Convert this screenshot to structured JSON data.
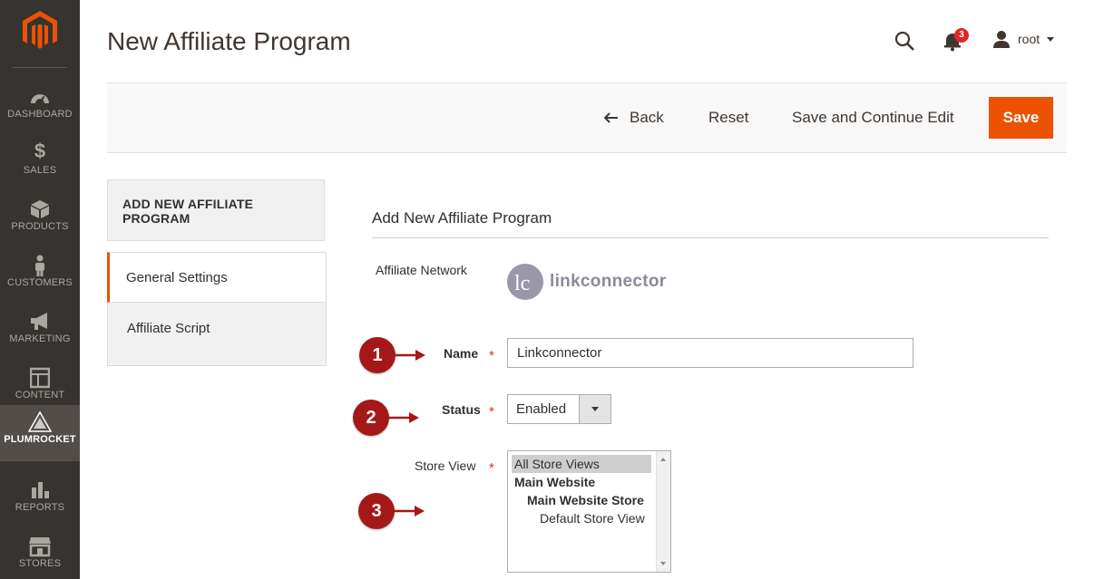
{
  "sidebar": {
    "logo_icon": "magento-logo-icon",
    "items": [
      {
        "label": "DASHBOARD",
        "icon": "dashboard-icon"
      },
      {
        "label": "SALES",
        "icon": "dollar-icon"
      },
      {
        "label": "PRODUCTS",
        "icon": "box-icon"
      },
      {
        "label": "CUSTOMERS",
        "icon": "person-icon"
      },
      {
        "label": "MARKETING",
        "icon": "megaphone-icon"
      },
      {
        "label": "CONTENT",
        "icon": "layout-icon"
      },
      {
        "label": "PLUMROCKET",
        "icon": "plumrocket-icon"
      },
      {
        "label": "REPORTS",
        "icon": "bar-chart-icon"
      },
      {
        "label": "STORES",
        "icon": "store-icon"
      }
    ]
  },
  "header": {
    "title": "New Affiliate Program",
    "notifications_count": "3",
    "user_name": "root"
  },
  "actions": {
    "back_label": "Back",
    "reset_label": "Reset",
    "save_continue_label": "Save and Continue Edit",
    "save_label": "Save"
  },
  "tabs": {
    "heading": "ADD NEW AFFILIATE PROGRAM",
    "items": [
      {
        "label": "General Settings",
        "active": true
      },
      {
        "label": "Affiliate Script",
        "active": false
      }
    ]
  },
  "form": {
    "section_title": "Add New Affiliate Program",
    "network_label": "Affiliate Network",
    "network_logo_text": "linkconnector",
    "name_label": "Name",
    "name_value": "Linkconnector",
    "status_label": "Status",
    "status_value": "Enabled",
    "store_view_label": "Store View",
    "store_options": [
      "All Store Views",
      "Main Website",
      "Main Website Store",
      "Default Store View"
    ],
    "required_mark": "*"
  },
  "callouts": [
    "1",
    "2",
    "3"
  ],
  "colors": {
    "sidebar_bg": "#373330",
    "accent": "#eb5202",
    "callout": "#a51818"
  }
}
